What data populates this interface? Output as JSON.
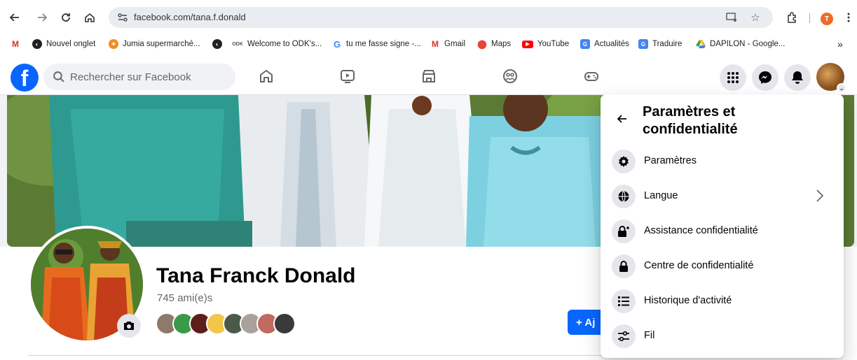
{
  "browser": {
    "url": "facebook.com/tana.f.donald",
    "profile_initial": "T",
    "bookmarks": [
      {
        "label": "",
        "icon": "gmail-icon"
      },
      {
        "label": "Nouvel onglet",
        "icon": "globe-icon"
      },
      {
        "label": "Jumia supermarché...",
        "icon": "jumia-icon"
      },
      {
        "label": "",
        "icon": "globe-icon"
      },
      {
        "label": "Welcome to ODK's...",
        "icon": "odk-icon"
      },
      {
        "label": "tu me fasse signe -...",
        "icon": "google-icon"
      },
      {
        "label": "Gmail",
        "icon": "gmail-icon"
      },
      {
        "label": "Maps",
        "icon": "maps-icon"
      },
      {
        "label": "YouTube",
        "icon": "youtube-icon"
      },
      {
        "label": "Actualités",
        "icon": "news-icon"
      },
      {
        "label": "Traduire",
        "icon": "translate-icon"
      },
      {
        "label": "DAPILON - Google...",
        "icon": "drive-icon"
      }
    ],
    "bookmarks_overflow": "»"
  },
  "facebook": {
    "logo": "f",
    "search_placeholder": "Rechercher sur Facebook"
  },
  "profile": {
    "name": "Tana Franck Donald",
    "friends_count": "745 ami(e)s",
    "add_button_label": "+ Aj"
  },
  "dropdown": {
    "title": "Paramètres et confidentialité",
    "items": [
      {
        "label": "Paramètres",
        "icon": "gear-icon",
        "has_chevron": false
      },
      {
        "label": "Langue",
        "icon": "globe-icon",
        "has_chevron": true
      },
      {
        "label": "Assistance confidentialité",
        "icon": "lock-plus-icon",
        "has_chevron": false
      },
      {
        "label": "Centre de confidentialité",
        "icon": "lock-icon",
        "has_chevron": false
      },
      {
        "label": "Historique d'activité",
        "icon": "list-icon",
        "has_chevron": false
      },
      {
        "label": "Fil",
        "icon": "sliders-icon",
        "has_chevron": false
      }
    ]
  },
  "colors": {
    "facebook_blue": "#0866ff",
    "chrome_profile": "#ee6b25"
  }
}
